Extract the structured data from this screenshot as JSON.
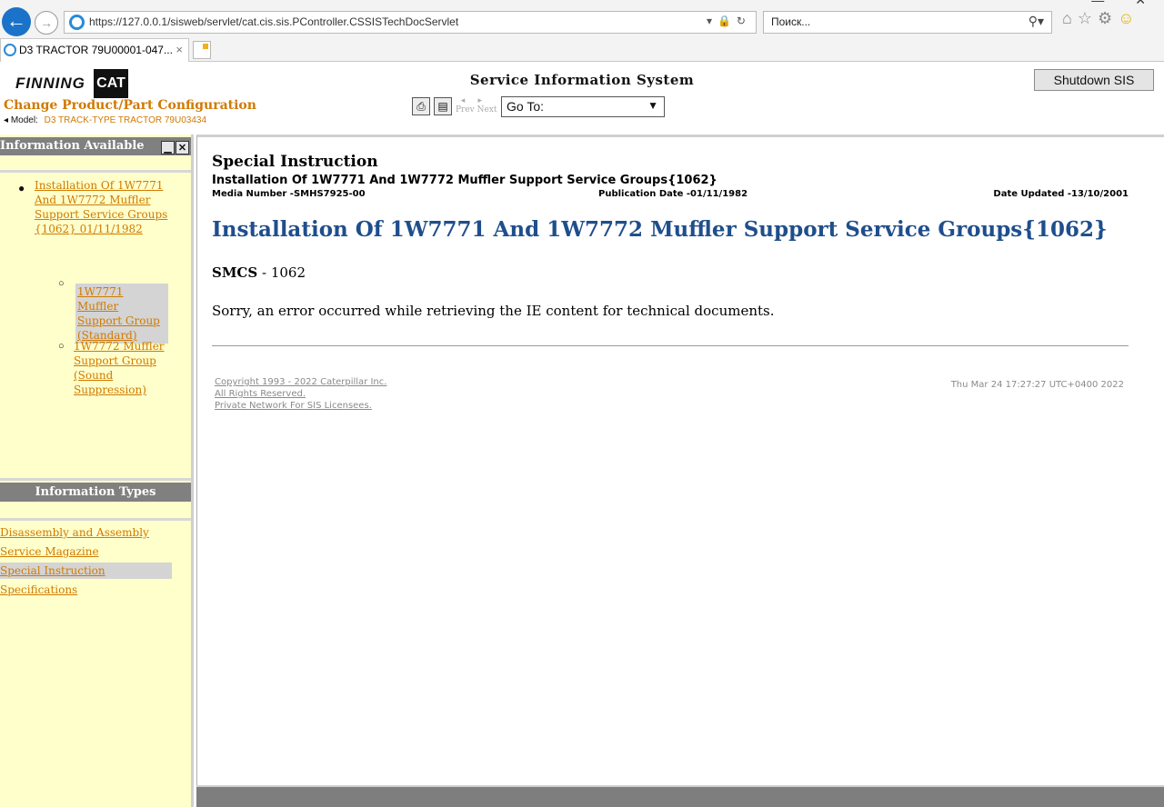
{
  "browser": {
    "address": "https://127.0.0.1/sisweb/servlet/cat.cis.sis.PController.CSSISTechDocServlet",
    "search_placeholder": "Поиск...",
    "tab_title": "D3 TRACTOR 79U00001-047...",
    "tab_close": "×"
  },
  "header": {
    "logo_text": "FINNING",
    "logo_cat": "CAT",
    "title": "Service Information System",
    "shutdown_label": "Shutdown SIS",
    "change_config": "Change Product/Part Configuration",
    "model_label": "Model:",
    "model_value": "D3 TRACK-TYPE TRACTOR 79U03434",
    "prev_label": "Prev",
    "next_label": "Next",
    "goto_label": "Go To:"
  },
  "left_panel": {
    "info_available_title": "Information Available",
    "tree": {
      "root": "Installation Of 1W7771 And 1W7772 Muffler Support Service Groups {1062} 01/11/1982",
      "children": [
        "1W7771 Muffler Support Group (Standard)",
        "1W7772 Muffler Support Group (Sound Suppression)"
      ]
    },
    "info_types_title": "Information Types",
    "types": [
      "Disassembly and Assembly",
      "Service Magazine",
      "Special Instruction",
      "Specifications"
    ],
    "selected_type": "Special Instruction"
  },
  "document": {
    "doc_type": "Special Instruction",
    "subtitle": "Installation Of 1W7771 And 1W7772 Muffler Support Service Groups{1062}",
    "media_number": "Media Number -SMHS7925-00",
    "publication_date": "Publication Date -01/11/1982",
    "date_updated": "Date Updated -13/10/2001",
    "heading": "Installation Of 1W7771 And 1W7772 Muffler Support Service Groups{1062}",
    "smcs_label": "SMCS",
    "smcs_value": " - 1062",
    "error_message": "Sorry, an error occurred while retrieving the IE content for technical documents.",
    "copyright_lines": [
      "Copyright 1993 - 2022 Caterpillar Inc.",
      "All Rights Reserved.",
      "Private Network For SIS Licensees."
    ],
    "timestamp": "Thu Mar 24 17:27:27 UTC+0400 2022"
  },
  "colors": {
    "link": "#d07a00",
    "heading_blue": "#1f4e8c",
    "panel_bg": "#ffffcc",
    "bar_gray": "#808080"
  }
}
